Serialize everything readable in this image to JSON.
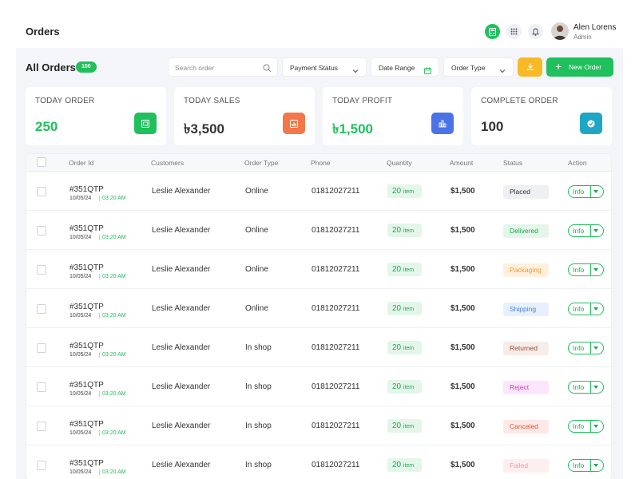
{
  "header": {
    "title": "Orders",
    "user_name": "Alen Lorens",
    "user_role": "Admin",
    "icons": [
      "calculator-icon",
      "apps-grid-icon",
      "bell-icon"
    ]
  },
  "toolbar": {
    "title": "All Orders",
    "count": "100",
    "search_placeholder": "Search order",
    "payment_status": "Payment Status",
    "date_range": "Date Range",
    "order_type": "Order Type",
    "new_order": "New Order"
  },
  "stats": [
    {
      "label": "TODAY ORDER",
      "value": "250",
      "color": "#20c05c",
      "icon_bg": "#20c05c",
      "icon": "wallet-icon"
    },
    {
      "label": "TODAY SALES",
      "value": "৳3,500",
      "color": "#333333",
      "icon_bg": "#f2784b",
      "icon": "bar-chart-icon"
    },
    {
      "label": "TODAY PROFIT",
      "value": "৳1,500",
      "color": "#20c05c",
      "icon_bg": "#4a73e8",
      "icon": "column-chart-icon"
    },
    {
      "label": "COMPLETE ORDER",
      "value": "100",
      "color": "#333333",
      "icon_bg": "#1ea7c5",
      "icon": "check-badge-icon"
    }
  ],
  "table": {
    "columns": [
      "Order Id",
      "Customers",
      "Order Type",
      "Phone",
      "Quantity",
      "Amount",
      "Status",
      "Action"
    ],
    "rows": [
      {
        "id": "#351QTP",
        "date": "10/05/24",
        "time": "03:20 AM",
        "customer": "Leslie Alexander",
        "type": "Online",
        "phone": "01812027211",
        "qty": "20",
        "qty_unit": "item",
        "amount": "$1,500",
        "status": "Placed",
        "action": "Info"
      },
      {
        "id": "#351QTP",
        "date": "10/05/24",
        "time": "03:20 AM",
        "customer": "Leslie Alexander",
        "type": "Online",
        "phone": "01812027211",
        "qty": "20",
        "qty_unit": "item",
        "amount": "$1,500",
        "status": "Delivered",
        "action": "Info"
      },
      {
        "id": "#351QTP",
        "date": "10/05/24",
        "time": "03:20 AM",
        "customer": "Leslie Alexander",
        "type": "Online",
        "phone": "01812027211",
        "qty": "20",
        "qty_unit": "item",
        "amount": "$1,500",
        "status": "Packaging",
        "action": "Info"
      },
      {
        "id": "#351QTP",
        "date": "10/05/24",
        "time": "03:20 AM",
        "customer": "Leslie Alexander",
        "type": "Online",
        "phone": "01812027211",
        "qty": "20",
        "qty_unit": "item",
        "amount": "$1,500",
        "status": "Shipping",
        "action": "Info"
      },
      {
        "id": "#351QTP",
        "date": "10/05/24",
        "time": "03:20 AM",
        "customer": "Leslie Alexander",
        "type": "In shop",
        "phone": "01812027211",
        "qty": "20",
        "qty_unit": "item",
        "amount": "$1,500",
        "status": "Returned",
        "action": "Info"
      },
      {
        "id": "#351QTP",
        "date": "10/05/24",
        "time": "03:20 AM",
        "customer": "Leslie Alexander",
        "type": "In shop",
        "phone": "01812027211",
        "qty": "20",
        "qty_unit": "item",
        "amount": "$1,500",
        "status": "Reject",
        "action": "Info"
      },
      {
        "id": "#351QTP",
        "date": "10/05/24",
        "time": "03:20 AM",
        "customer": "Leslie Alexander",
        "type": "In shop",
        "phone": "01812027211",
        "qty": "20",
        "qty_unit": "item",
        "amount": "$1,500",
        "status": "Canceled",
        "action": "Info"
      },
      {
        "id": "#351QTP",
        "date": "10/05/24",
        "time": "03:20 AM",
        "customer": "Leslie Alexander",
        "type": "In shop",
        "phone": "01812027211",
        "qty": "20",
        "qty_unit": "item",
        "amount": "$1,500",
        "status": "Failed",
        "action": "Info"
      }
    ]
  },
  "status_colors": {
    "Placed": {
      "bg": "#eef0f3",
      "fg": "#333333"
    },
    "Delivered": {
      "bg": "#e3f6e9",
      "fg": "#20a852"
    },
    "Packaging": {
      "bg": "#fff0de",
      "fg": "#f39a2b"
    },
    "Shipping": {
      "bg": "#e6f0ff",
      "fg": "#4a7fe0"
    },
    "Returned": {
      "bg": "#f6ece8",
      "fg": "#9a4a3a"
    },
    "Reject": {
      "bg": "#fde6fb",
      "fg": "#c43bc0"
    },
    "Canceled": {
      "bg": "#fde9e6",
      "fg": "#e8543a"
    },
    "Failed": {
      "bg": "#fdeef0",
      "fg": "#f09aa8"
    }
  }
}
